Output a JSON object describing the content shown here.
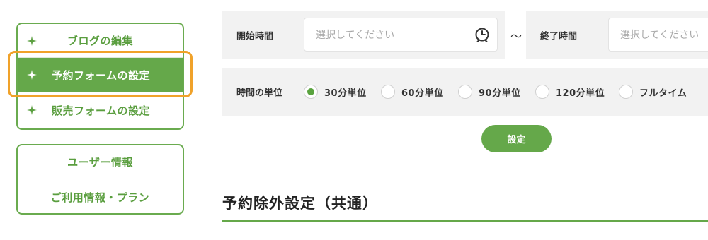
{
  "sidebar": {
    "primary_items": [
      {
        "label": "ブログの編集",
        "icon": "sparkle-icon"
      },
      {
        "label": "予約フォームの設定",
        "icon": "sparkle-icon"
      },
      {
        "label": "販売フォームの設定",
        "icon": "sparkle-icon"
      }
    ],
    "active_index": 1,
    "secondary_items": [
      {
        "label": "ユーザー情報"
      },
      {
        "label": "ご利用情報・プラン"
      }
    ]
  },
  "time_range": {
    "start_label": "開始時間",
    "start_placeholder": "選択してください",
    "separator": "〜",
    "end_label": "終了時間",
    "end_placeholder": "選択してください",
    "clock_icon": "clock-icon"
  },
  "time_unit": {
    "label": "時間の単位",
    "options": [
      "30分単位",
      "60分単位",
      "90分単位",
      "120分単位",
      "フルタイム"
    ],
    "selected_index": 0
  },
  "submit": {
    "label": "設定"
  },
  "section": {
    "title": "予約除外設定（共通）"
  },
  "colors": {
    "accent_green": "#65a84a",
    "highlight_orange": "#f0a22a",
    "panel_gray": "#f2f2f2"
  }
}
